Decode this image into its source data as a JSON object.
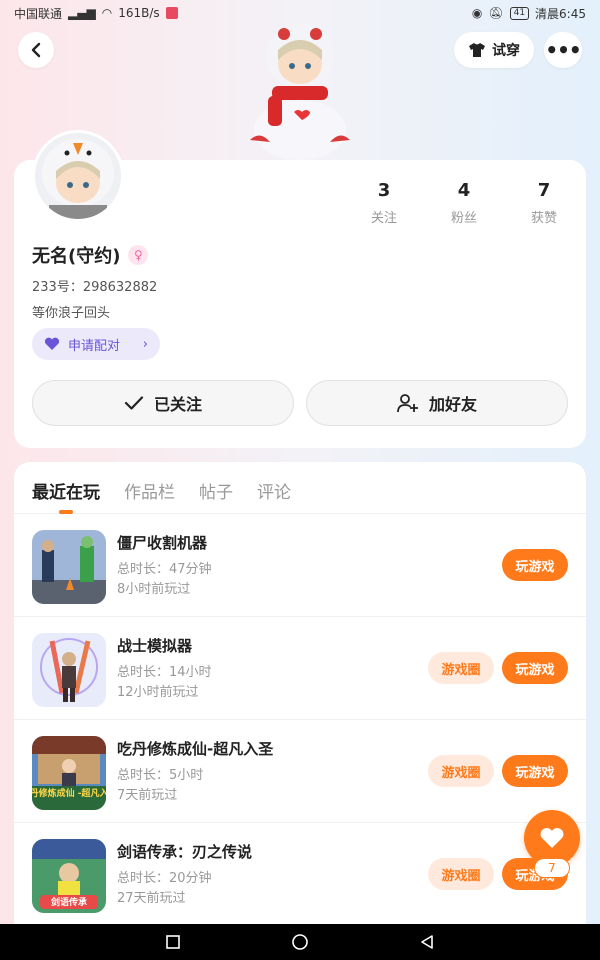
{
  "status_bar": {
    "carrier": "中国联通",
    "speed": "161B/s",
    "battery": "41",
    "time": "清晨6:45"
  },
  "header": {
    "try_on_label": "试穿",
    "more_label": "•••"
  },
  "profile": {
    "name": "无名(守约)",
    "gender_symbol": "♀",
    "uid": "233号：298632882",
    "bio": "等你浪子回头",
    "pair_label": "申请配对",
    "stats": [
      {
        "value": "3",
        "label": "关注"
      },
      {
        "value": "4",
        "label": "粉丝"
      },
      {
        "value": "7",
        "label": "获赞"
      }
    ],
    "follow_label": "已关注",
    "add_friend_label": "加好友"
  },
  "tabs": [
    {
      "label": "最近在玩",
      "active": true
    },
    {
      "label": "作品栏",
      "active": false
    },
    {
      "label": "帖子",
      "active": false
    },
    {
      "label": "评论",
      "active": false
    }
  ],
  "games": [
    {
      "title": "僵尸收割机器",
      "duration": "总时长：47分钟",
      "last_played": "8小时前玩过",
      "has_circle": false,
      "play_label": "玩游戏",
      "circle_label": ""
    },
    {
      "title": "战士模拟器",
      "duration": "总时长：14小时",
      "last_played": "12小时前玩过",
      "has_circle": true,
      "play_label": "玩游戏",
      "circle_label": "游戏圈"
    },
    {
      "title": "吃丹修炼成仙-超凡入圣",
      "duration": "总时长：5小时",
      "last_played": "7天前玩过",
      "has_circle": true,
      "play_label": "玩游戏",
      "circle_label": "游戏圈"
    },
    {
      "title": "剑语传承：刃之传说",
      "duration": "总时长：20分钟",
      "last_played": "27天前玩过",
      "has_circle": true,
      "play_label": "玩游戏",
      "circle_label": "游戏圈"
    }
  ],
  "game_icon_texts": {
    "game3": "吃丹修炼成仙 -超凡入圣",
    "game4": "剑语传承"
  },
  "favorite_count": "7",
  "colors": {
    "accent": "#ff7a1a",
    "pair_bg": "#ece9fb",
    "pair_text": "#6a55d8"
  }
}
